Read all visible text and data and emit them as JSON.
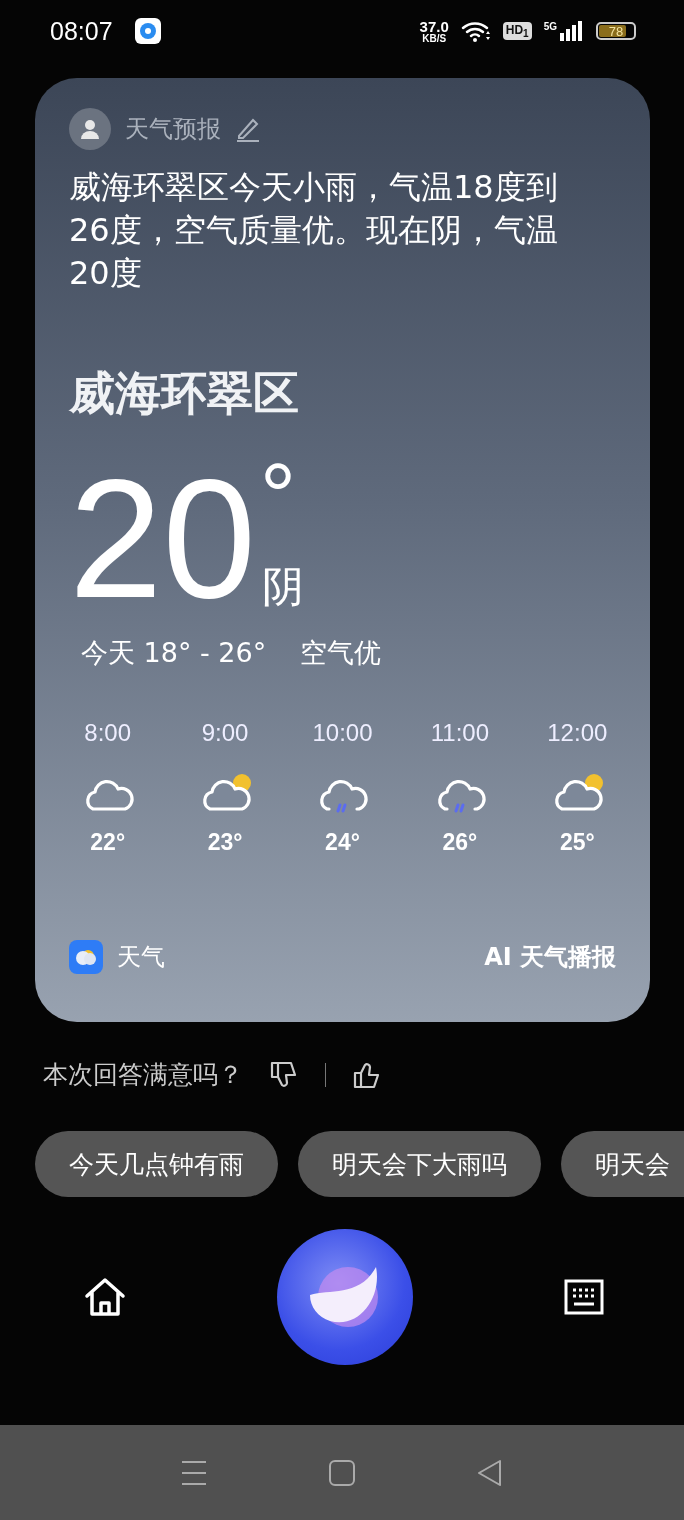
{
  "status_bar": {
    "time": "08:07",
    "net_speed": "37.0",
    "net_unit": "KB/S",
    "hd": "HD$_{1}$",
    "network": "5G",
    "battery": {
      "label": "78",
      "level": 0.78
    }
  },
  "card": {
    "source": "天气预报",
    "summary": "威海环翠区今天小雨，气温18度到26度，空气质量优。现在阴，气温20度",
    "city": "威海环翠区",
    "temperature": "20",
    "degree": "°",
    "condition": "阴",
    "range": "今天 18° - 26°",
    "air": "空气优",
    "hourly": [
      {
        "time": "8:00",
        "kind": "cloudy",
        "temp": "22°"
      },
      {
        "time": "9:00",
        "kind": "partly_cloudy",
        "temp": "23°"
      },
      {
        "time": "10:00",
        "kind": "rain",
        "temp": "24°"
      },
      {
        "time": "11:00",
        "kind": "rain",
        "temp": "26°"
      },
      {
        "time": "12:00",
        "kind": "partly_cloudy",
        "temp": "25°"
      }
    ],
    "app_name": "天气",
    "ai_label": "AI 天气播报"
  },
  "feedback": {
    "question": "本次回答满意吗？"
  },
  "suggestions": [
    "今天几点钟有雨",
    "明天会下大雨吗",
    "明天会"
  ]
}
